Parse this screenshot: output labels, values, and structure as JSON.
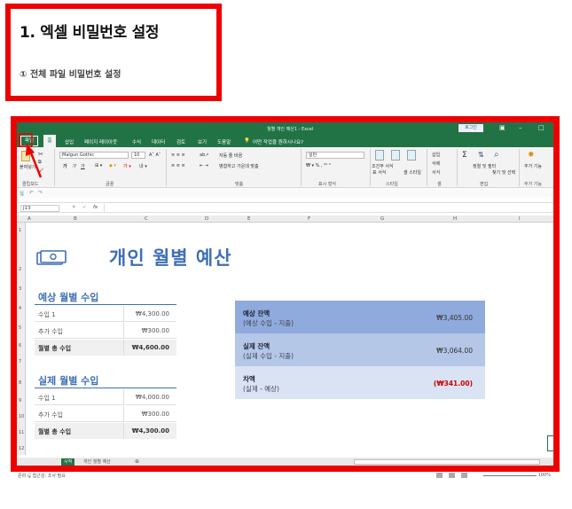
{
  "step": {
    "title": "1. 엑셀 비밀번호 설정",
    "subtitle": "① 전체 파일 비밀번호 설정"
  },
  "excel": {
    "window_title": "월별 개인 예산1 - Excel",
    "login_label": "로그인",
    "menu": {
      "file": "파일",
      "home": "홈",
      "items": [
        "삽입",
        "페이지 레이아웃",
        "수식",
        "데이터",
        "검토",
        "보기",
        "도움말"
      ],
      "tell_me": "어떤 작업을 원하시나요?"
    },
    "ribbon": {
      "paste_label": "붙여넣기",
      "font_name": "Malgun Gothic",
      "font_size": "10",
      "wrap_text": "자동 줄 바꿈",
      "merge_center": "병합하고 가운데 맞춤",
      "number_format": "일반",
      "conditional_format": "조건부 서식",
      "format_table": "표 서식",
      "cell_style": "셀 스타일",
      "insert_label": "삽입",
      "delete_label": "삭제",
      "format_label": "서식",
      "sort_filter": "정렬 및 필터",
      "find_select": "찾기 및 선택",
      "addins": "추가 기능",
      "groups": [
        "클립보드",
        "글꼴",
        "맞춤",
        "표시 형식",
        "스타일",
        "셀",
        "편집",
        "추가 기능"
      ]
    },
    "name_box": "J13",
    "columns": [
      "A",
      "B",
      "C",
      "D",
      "E",
      "F",
      "G",
      "H",
      "I"
    ],
    "rows": [
      "1",
      "2",
      "3",
      "4",
      "5",
      "6",
      "7",
      "8",
      "9",
      "10",
      "11",
      "12"
    ],
    "sheet": {
      "title": "개인 월별 예산",
      "expected_title": "예상 월별 수입",
      "expected_rows": [
        {
          "label": "수입 1",
          "value": "₩4,300.00"
        },
        {
          "label": "추가 수입",
          "value": "₩300.00"
        }
      ],
      "expected_total": {
        "label": "월별 총 수입",
        "value": "₩4,600.00"
      },
      "actual_title": "실제 월별 수입",
      "actual_rows": [
        {
          "label": "수입 1",
          "value": "₩4,000.00"
        },
        {
          "label": "추가 수입",
          "value": "₩300.00"
        }
      ],
      "actual_total": {
        "label": "월별 총 수입",
        "value": "₩4,300.00"
      },
      "balances": [
        {
          "line1": "예상 잔액",
          "line2": "(예상 수입 - 지출)",
          "value": "₩3,405.00",
          "color": "#8faadc"
        },
        {
          "line1": "실제 잔액",
          "line2": "(실제 수입 - 지출)",
          "value": "₩3,064.00",
          "color": "#b4c7e7"
        },
        {
          "line1": "차액",
          "line2": "(실제 - 예상)",
          "value": "(₩341.00)",
          "color": "#dae3f3"
        }
      ]
    },
    "tabs": {
      "active": "시작",
      "second": "개인 월별 예산",
      "add": "⊕"
    },
    "status": {
      "left": "준비   🖫 접근성: 조사 필요",
      "zoom": "100%"
    }
  },
  "colors": {
    "accent_red": "#ee0000",
    "excel_green": "#217346",
    "title_blue": "#3f6fb5"
  }
}
